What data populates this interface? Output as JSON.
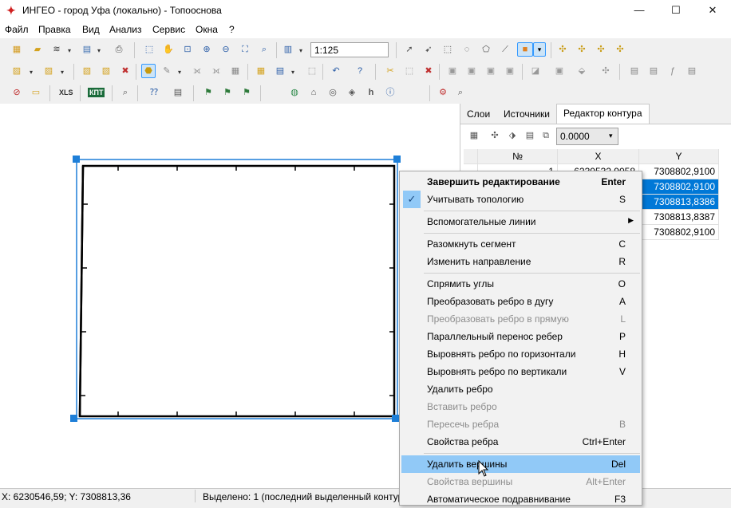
{
  "window": {
    "title": "ИНГЕО - город Уфа (локально) - Топооснова",
    "app_icon": "ingeo-logo-icon",
    "minimize": "—",
    "maximize": "☐",
    "close": "✕"
  },
  "menu": [
    "Файл",
    "Правка",
    "Вид",
    "Анализ",
    "Сервис",
    "Окна",
    "?"
  ],
  "toolbar": {
    "scale_value": "1:125",
    "xls_label": "XLS",
    "kpt_label": "КПТ",
    "icons_row1": [
      "layers-icon",
      "open-folder-icon",
      "stack-icon",
      "search-doc-icon",
      "print-icon",
      "select-rect-icon",
      "pan-hand-icon",
      "zoom-rect-icon",
      "zoom-in-icon",
      "zoom-out-icon",
      "zoom-extent-icon",
      "find-object-icon",
      "view-options-icon",
      "pointer-icon",
      "pointer-add-icon",
      "select-area-icon",
      "select-circle-icon",
      "select-poly-icon",
      "select-line-icon",
      "layer-color-icon",
      "object-rotate-icon",
      "object-mirror-icon",
      "object-swap-icon",
      "object-scale-icon"
    ],
    "icons_row2": [
      "new-object-icon",
      "copy-object-icon",
      "merge-object-icon",
      "delete-object-icon",
      "edit-contour-icon",
      "pencil-icon",
      "split-icon",
      "join-icon",
      "properties-icon",
      "table-icon",
      "link-icon",
      "undo-icon",
      "help-cursor-icon",
      "cut-icon",
      "trim-icon",
      "extend-icon",
      "group-icon",
      "ungroup-icon",
      "union-icon",
      "intersect-icon",
      "subtract-icon",
      "fill-icon",
      "frame-icon",
      "anchor-icon",
      "move-node-icon",
      "report-icon",
      "report2-icon",
      "formula-icon",
      "document-icon"
    ],
    "icons_row3": [
      "no-entry-icon",
      "note-icon",
      "xls-icon",
      "kpt-icon",
      "magnifier-icon",
      "question-marks-icon",
      "stats-icon",
      "flag1-icon",
      "flag2-icon",
      "flag3-icon",
      "globe-icon",
      "house-icon",
      "target-icon",
      "direction-icon",
      "height-icon",
      "info-icon",
      "map-settings-icon",
      "map-zoom-icon"
    ]
  },
  "panel": {
    "tabs": [
      "Слои",
      "Источники",
      "Редактор контура"
    ],
    "active_tab": "Редактор контура",
    "precision_value": "0.0000",
    "columns": [
      "№",
      "X",
      "Y"
    ],
    "rows": [
      {
        "n": "1",
        "x": "6230532,9058",
        "y": "7308802,9100",
        "selected": false
      },
      {
        "n": "",
        "x": "",
        "y": "7308802,9100",
        "selected": true
      },
      {
        "n": "",
        "x": "",
        "y": "7308813,8386",
        "selected": true
      },
      {
        "n": "",
        "x": "",
        "y": "7308813,8387",
        "selected": false
      },
      {
        "n": "",
        "x": "",
        "y": "7308802,9100",
        "selected": false
      }
    ]
  },
  "context_menu": {
    "items": [
      {
        "label": "Завершить редактирование",
        "key": "Enter",
        "bold": true
      },
      {
        "label": "Учитывать топологию",
        "key": "S",
        "checked": true
      },
      {
        "label": "Вспомогательные линии",
        "key": "",
        "submenu": true
      },
      {
        "label": "Разомкнуть сегмент",
        "key": "C"
      },
      {
        "label": "Изменить направление",
        "key": "R"
      },
      {
        "label": "Спрямить углы",
        "key": "O"
      },
      {
        "label": "Преобразовать ребро в дугу",
        "key": "A"
      },
      {
        "label": "Преобразовать ребро в прямую",
        "key": "L",
        "disabled": true
      },
      {
        "label": "Параллельный перенос ребер",
        "key": "P"
      },
      {
        "label": "Выровнять ребро по горизонтали",
        "key": "H"
      },
      {
        "label": "Выровнять ребро по вертикали",
        "key": "V"
      },
      {
        "label": "Удалить ребро",
        "key": ""
      },
      {
        "label": "Вставить ребро",
        "key": "",
        "disabled": true
      },
      {
        "label": "Пересечь ребра",
        "key": "B",
        "disabled": true
      },
      {
        "label": "Свойства ребра",
        "key": "Ctrl+Enter"
      },
      {
        "label": "Удалить вершины",
        "key": "Del",
        "highlighted": true
      },
      {
        "label": "Свойства вершины",
        "key": "Alt+Enter",
        "disabled": true
      },
      {
        "label": "Автоматическое подравнивание",
        "key": "F3"
      }
    ]
  },
  "status": {
    "coords": "X: 6230546,59; Y: 7308813,36",
    "selection": "Выделено: 1 (последний выделенный контур"
  },
  "colors": {
    "selection_blue": "#0078d7",
    "menu_highlight": "#91c9f7",
    "handle_blue": "#1e7fd8"
  }
}
